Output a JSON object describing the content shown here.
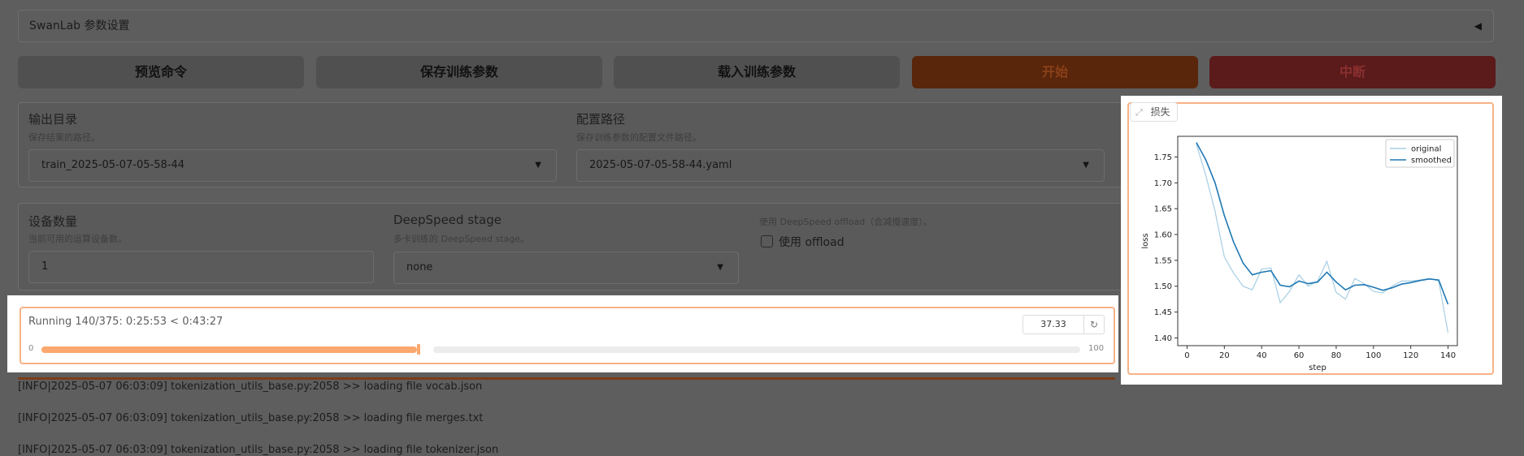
{
  "swanlab": {
    "title": "SwanLab 参数设置",
    "toggle": "◀"
  },
  "actions": {
    "preview": "预览命令",
    "save": "保存训练参数",
    "load": "载入训练参数",
    "start": "开始",
    "stop": "中断"
  },
  "output": {
    "label": "输出目录",
    "desc": "保存结果的路径。",
    "value": "train_2025-05-07-05-58-44"
  },
  "config": {
    "label": "配置路径",
    "desc": "保存训练参数的配置文件路径。",
    "value": "2025-05-07-05-58-44.yaml"
  },
  "devices": {
    "label": "设备数量",
    "desc": "当前可用的运算设备数。",
    "value": "1"
  },
  "deepspeed": {
    "label": "DeepSpeed stage",
    "desc": "多卡训练的 DeepSpeed stage。",
    "value": "none"
  },
  "offload": {
    "desc": "使用 DeepSpeed offload（会减慢速度）。",
    "label": "使用 offload"
  },
  "progress": {
    "status": "Running 140/375: 0:25:53 < 0:43:27",
    "value": "37.33",
    "fraction": 0.3733,
    "min": "0",
    "max": "100",
    "reset_icon": "reset-icon"
  },
  "logs": [
    "[INFO|2025-05-07 06:03:09] tokenization_utils_base.py:2058 >> loading file vocab.json",
    "[INFO|2025-05-07 06:03:09] tokenization_utils_base.py:2058 >> loading file merges.txt",
    "[INFO|2025-05-07 06:03:09] tokenization_utils_base.py:2058 >> loading file tokenizer.json"
  ],
  "plot": {
    "tag": "损失",
    "tag_icon": "chart-icon"
  },
  "colors": {
    "accent": "#f7b286",
    "start": "#59260b",
    "stop": "#5b1b1b",
    "original": "#a6cee3",
    "smoothed": "#1f78b4"
  },
  "chart_data": {
    "type": "line",
    "xlabel": "step",
    "ylabel": "loss",
    "xlim": [
      -5,
      145
    ],
    "ylim": [
      1.385,
      1.79
    ],
    "xticks": [
      0,
      20,
      40,
      60,
      80,
      100,
      120,
      140
    ],
    "yticks": [
      1.4,
      1.45,
      1.5,
      1.55,
      1.6,
      1.65,
      1.7,
      1.75
    ],
    "legend": "top-right",
    "series": [
      {
        "name": "original",
        "x": [
          5,
          10,
          15,
          20,
          25,
          30,
          35,
          40,
          45,
          50,
          55,
          60,
          65,
          70,
          75,
          80,
          85,
          90,
          95,
          100,
          105,
          110,
          115,
          120,
          125,
          130,
          135,
          140
        ],
        "y": [
          1.775,
          1.715,
          1.645,
          1.557,
          1.525,
          1.5,
          1.493,
          1.533,
          1.535,
          1.468,
          1.49,
          1.522,
          1.5,
          1.51,
          1.548,
          1.488,
          1.475,
          1.515,
          1.505,
          1.49,
          1.487,
          1.5,
          1.51,
          1.51,
          1.512,
          1.515,
          1.51,
          1.41
        ]
      },
      {
        "name": "smoothed",
        "x": [
          5,
          10,
          15,
          20,
          25,
          30,
          35,
          40,
          45,
          50,
          55,
          60,
          65,
          70,
          75,
          80,
          85,
          90,
          95,
          100,
          105,
          110,
          115,
          120,
          125,
          130,
          135,
          140
        ],
        "y": [
          1.778,
          1.745,
          1.7,
          1.637,
          1.585,
          1.545,
          1.522,
          1.527,
          1.53,
          1.502,
          1.499,
          1.51,
          1.505,
          1.508,
          1.527,
          1.508,
          1.493,
          1.502,
          1.503,
          1.498,
          1.492,
          1.497,
          1.504,
          1.507,
          1.511,
          1.514,
          1.512,
          1.465
        ]
      }
    ]
  }
}
